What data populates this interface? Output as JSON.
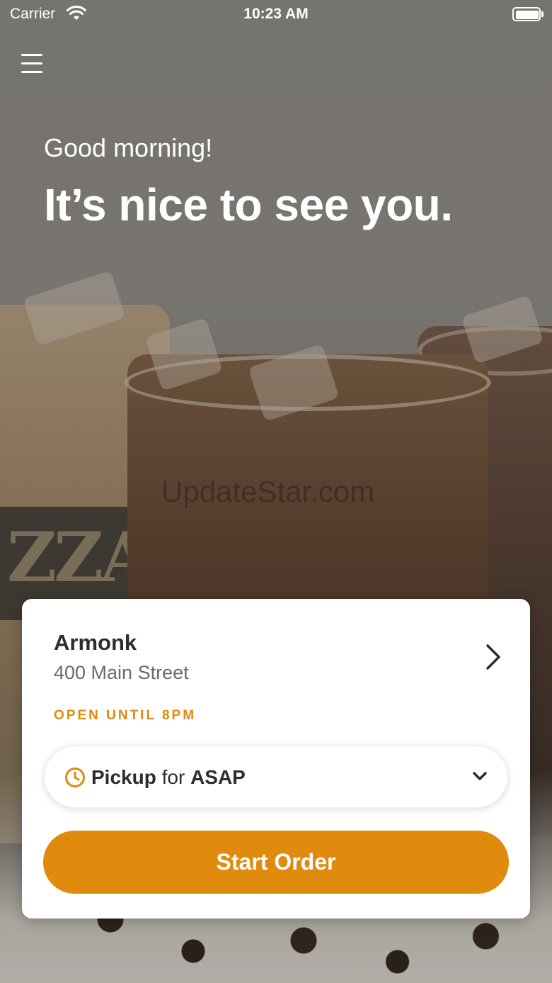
{
  "status_bar": {
    "carrier": "Carrier",
    "time": "10:23 AM",
    "wifi_icon": "wifi-icon",
    "battery_icon": "battery-icon"
  },
  "header": {
    "menu_icon": "hamburger-menu-icon",
    "greeting": "Good morning!",
    "headline": "It’s nice to see you."
  },
  "background": {
    "description_icon": "coffee-background-image",
    "watermark": "UpdateStar.com",
    "cup_label": "ZZA"
  },
  "store_card": {
    "name": "Armonk",
    "address": "400 Main Street",
    "hours": "OPEN UNTIL 8PM",
    "pickup": {
      "mode": "Pickup",
      "connector": "for",
      "time": "ASAP"
    },
    "start_order_label": "Start Order"
  },
  "colors": {
    "accent": "#e08a0e",
    "card_bg": "#ffffff",
    "text_dark": "#2d2d2d",
    "text_muted": "#6b6b6b"
  }
}
